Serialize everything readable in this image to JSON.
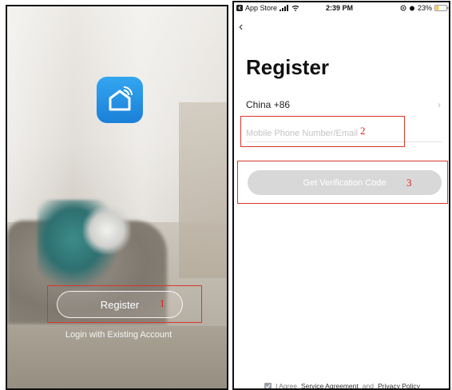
{
  "left": {
    "register_label": "Register",
    "annotation_1": "1",
    "login_label": "Login with Existing Account"
  },
  "right": {
    "status": {
      "carrier": "App Store",
      "time": "2:39 PM",
      "battery": "23%"
    },
    "title": "Register",
    "country": "China +86",
    "phone_placeholder": "Mobile Phone Number/Email",
    "annotation_2": "2",
    "verify_label": "Get Verification Code",
    "annotation_3": "3",
    "agree_prefix": "I Agree",
    "service_agreement": "Service Agreement",
    "and_word": "and",
    "privacy_policy": "Privacy Policy"
  },
  "colors": {
    "accent_blue": "#1b8be0",
    "annotation_red": "#d8362a",
    "disabled_button": "#d8d8d8"
  }
}
